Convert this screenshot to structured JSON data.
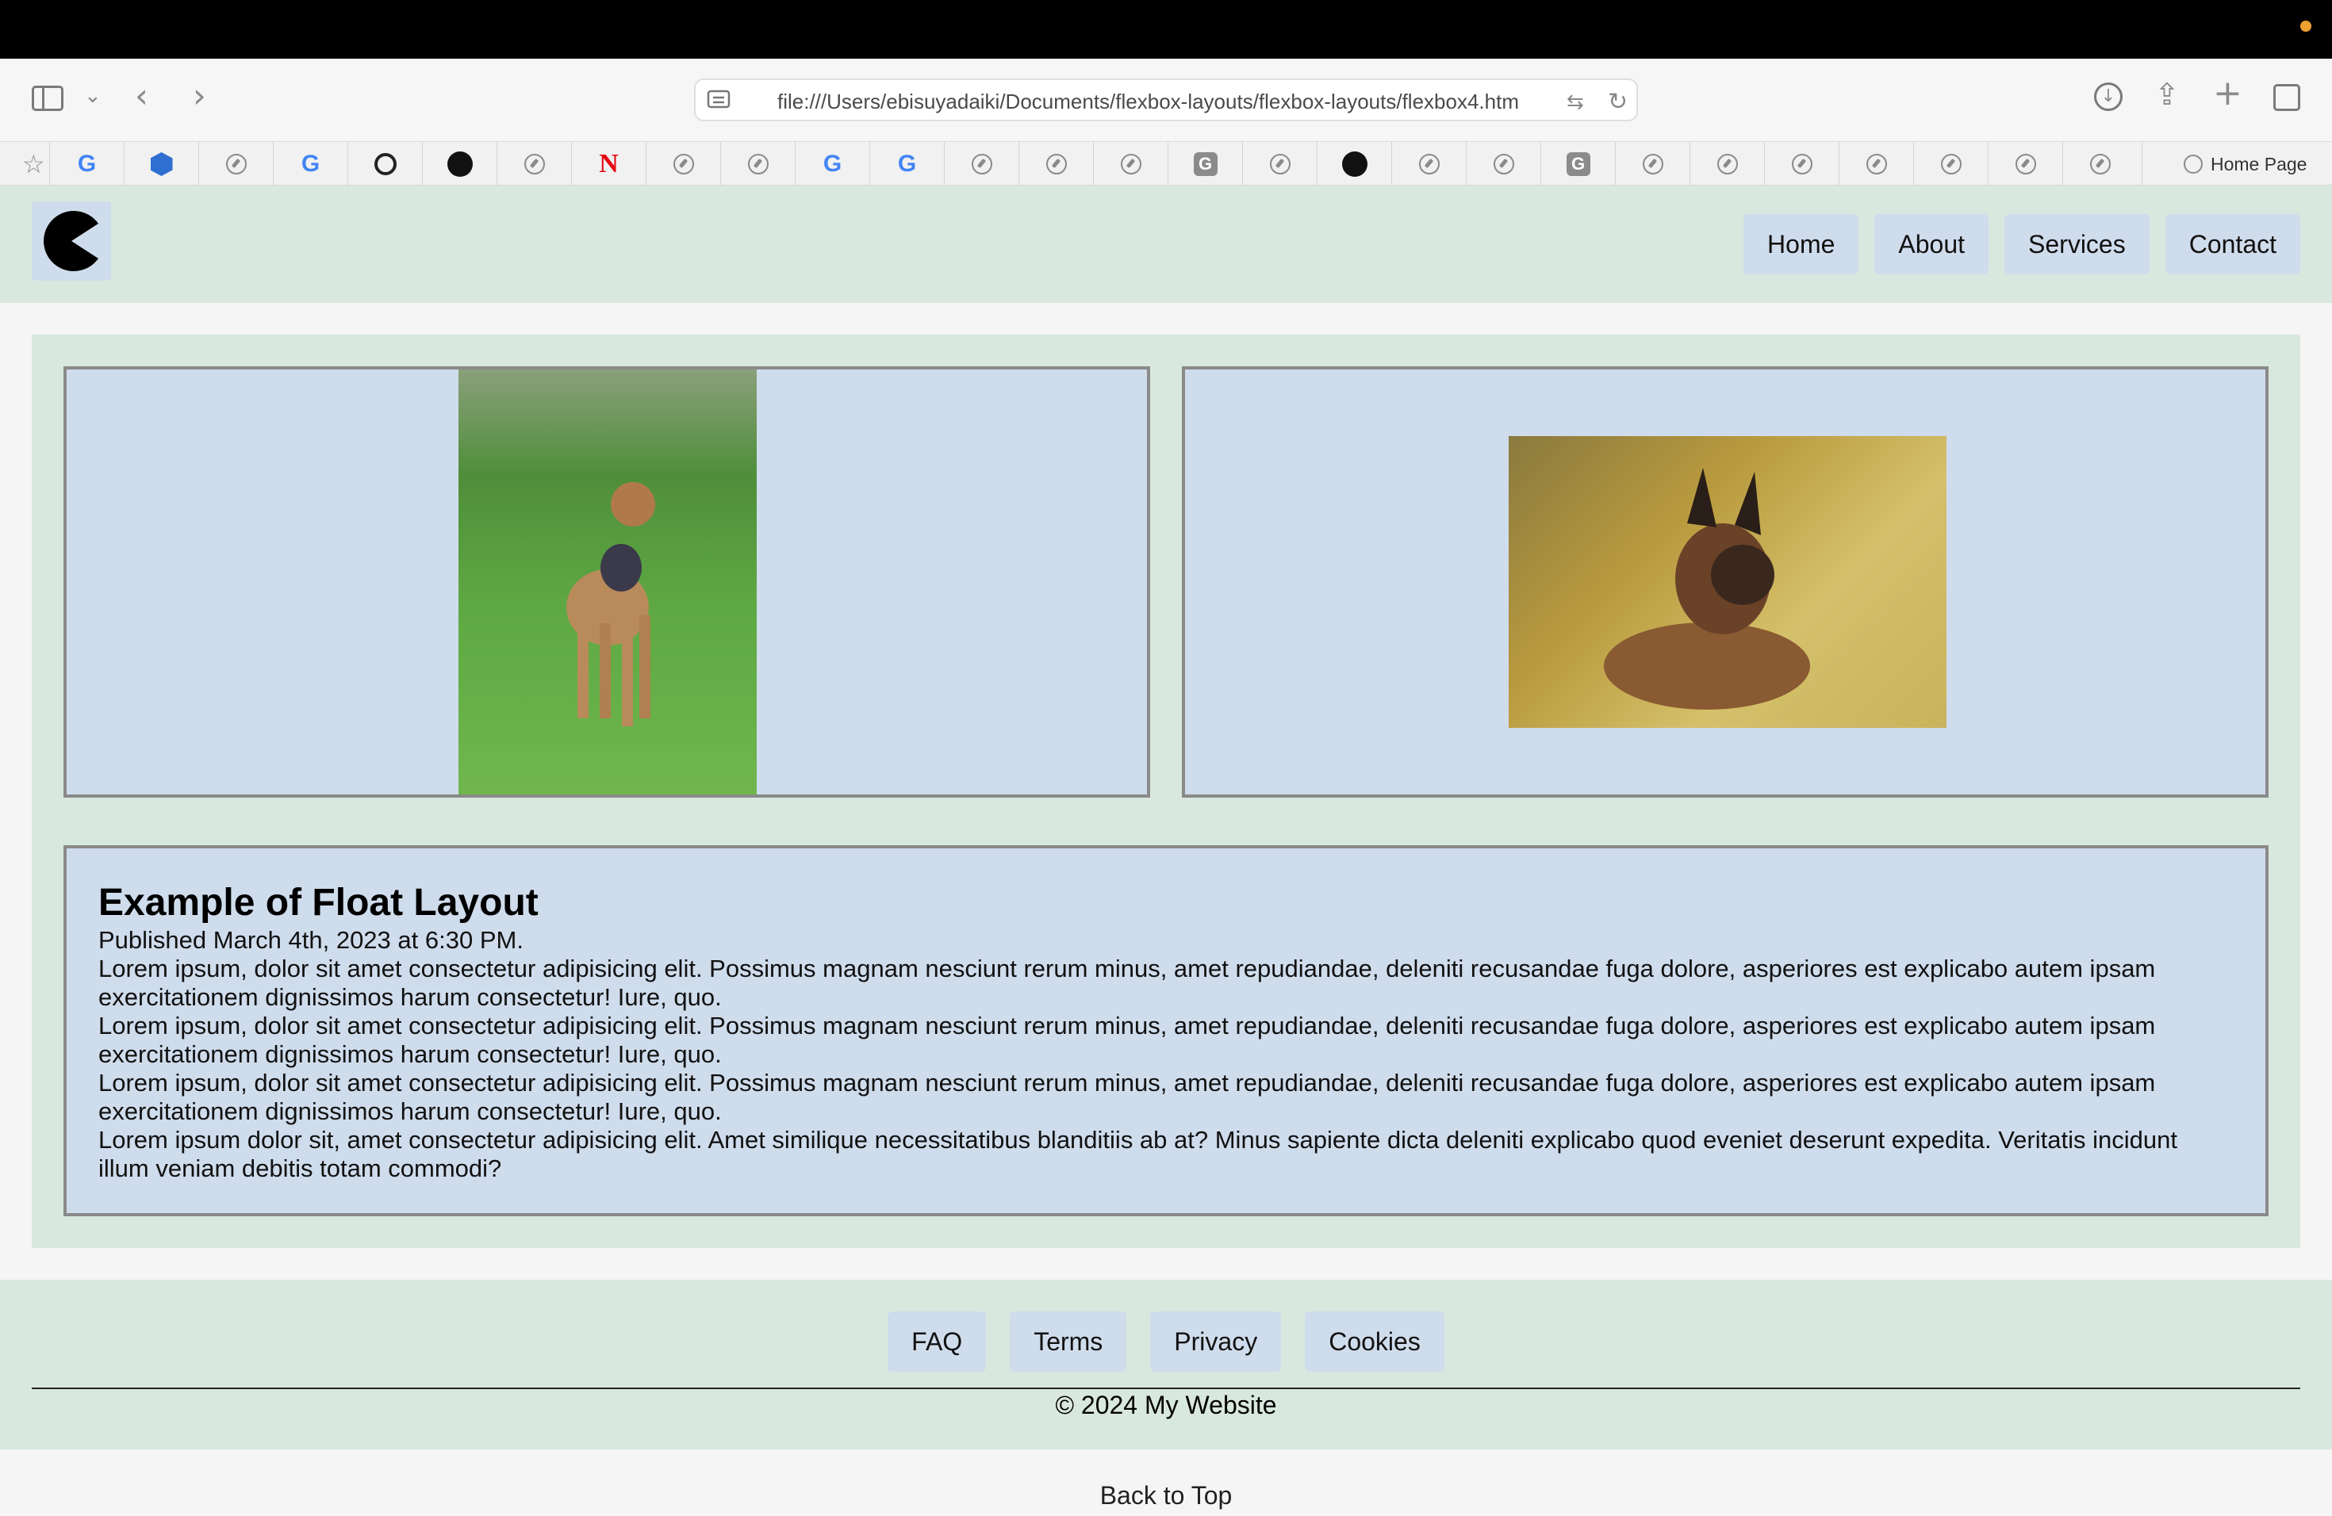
{
  "browser": {
    "url": "file:///Users/ebisuyadaiki/Documents/flexbox-layouts/flexbox-layouts/flexbox4.htm",
    "home_page_label": "Home Page",
    "favorites": [
      {
        "icon": "google-icon"
      },
      {
        "icon": "hexagon-app-icon"
      },
      {
        "icon": "compass-icon"
      },
      {
        "icon": "google-icon"
      },
      {
        "icon": "openai-icon"
      },
      {
        "icon": "github-icon"
      },
      {
        "icon": "compass-icon"
      },
      {
        "icon": "netflix-icon"
      },
      {
        "icon": "compass-icon"
      },
      {
        "icon": "compass-icon"
      },
      {
        "icon": "google-icon"
      },
      {
        "icon": "google-icon"
      },
      {
        "icon": "compass-icon"
      },
      {
        "icon": "compass-icon"
      },
      {
        "icon": "compass-icon"
      },
      {
        "icon": "g-box-icon"
      },
      {
        "icon": "compass-icon"
      },
      {
        "icon": "github-icon"
      },
      {
        "icon": "compass-icon"
      },
      {
        "icon": "compass-icon"
      },
      {
        "icon": "g-box-icon"
      },
      {
        "icon": "compass-icon"
      },
      {
        "icon": "compass-icon"
      },
      {
        "icon": "compass-icon"
      },
      {
        "icon": "compass-icon"
      },
      {
        "icon": "compass-icon"
      },
      {
        "icon": "compass-icon"
      },
      {
        "icon": "compass-icon"
      }
    ]
  },
  "header": {
    "nav": [
      "Home",
      "About",
      "Services",
      "Contact"
    ]
  },
  "article": {
    "title": "Example of Float Layout",
    "published": "Published March 4th, 2023 at 6:30 PM.",
    "paragraphs": [
      "Lorem ipsum, dolor sit amet consectetur adipisicing elit. Possimus magnam nesciunt rerum minus, amet repudiandae, deleniti recusandae fuga dolore, asperiores est explicabo autem ipsam exercitationem dignissimos harum consectetur! Iure, quo.",
      "Lorem ipsum, dolor sit amet consectetur adipisicing elit. Possimus magnam nesciunt rerum minus, amet repudiandae, deleniti recusandae fuga dolore, asperiores est explicabo autem ipsam exercitationem dignissimos harum consectetur! Iure, quo.",
      "Lorem ipsum, dolor sit amet consectetur adipisicing elit. Possimus magnam nesciunt rerum minus, amet repudiandae, deleniti recusandae fuga dolore, asperiores est explicabo autem ipsam exercitationem dignissimos harum consectetur! Iure, quo.",
      "Lorem ipsum dolor sit, amet consectetur adipisicing elit. Amet similique necessitatibus blanditiis ab at? Minus sapiente dicta deleniti explicabo quod eveniet deserunt expedita. Veritatis incidunt illum veniam debitis totam commodi?"
    ]
  },
  "footer": {
    "links": [
      "FAQ",
      "Terms",
      "Privacy",
      "Cookies"
    ],
    "copyright": "© 2024 My Website",
    "back_to_top": "Back to Top"
  },
  "colors": {
    "header_bg": "#d9e8df",
    "card_bg": "#cfdcec",
    "card_border": "#8a8a8a",
    "page_bg": "#f5f5f5"
  }
}
